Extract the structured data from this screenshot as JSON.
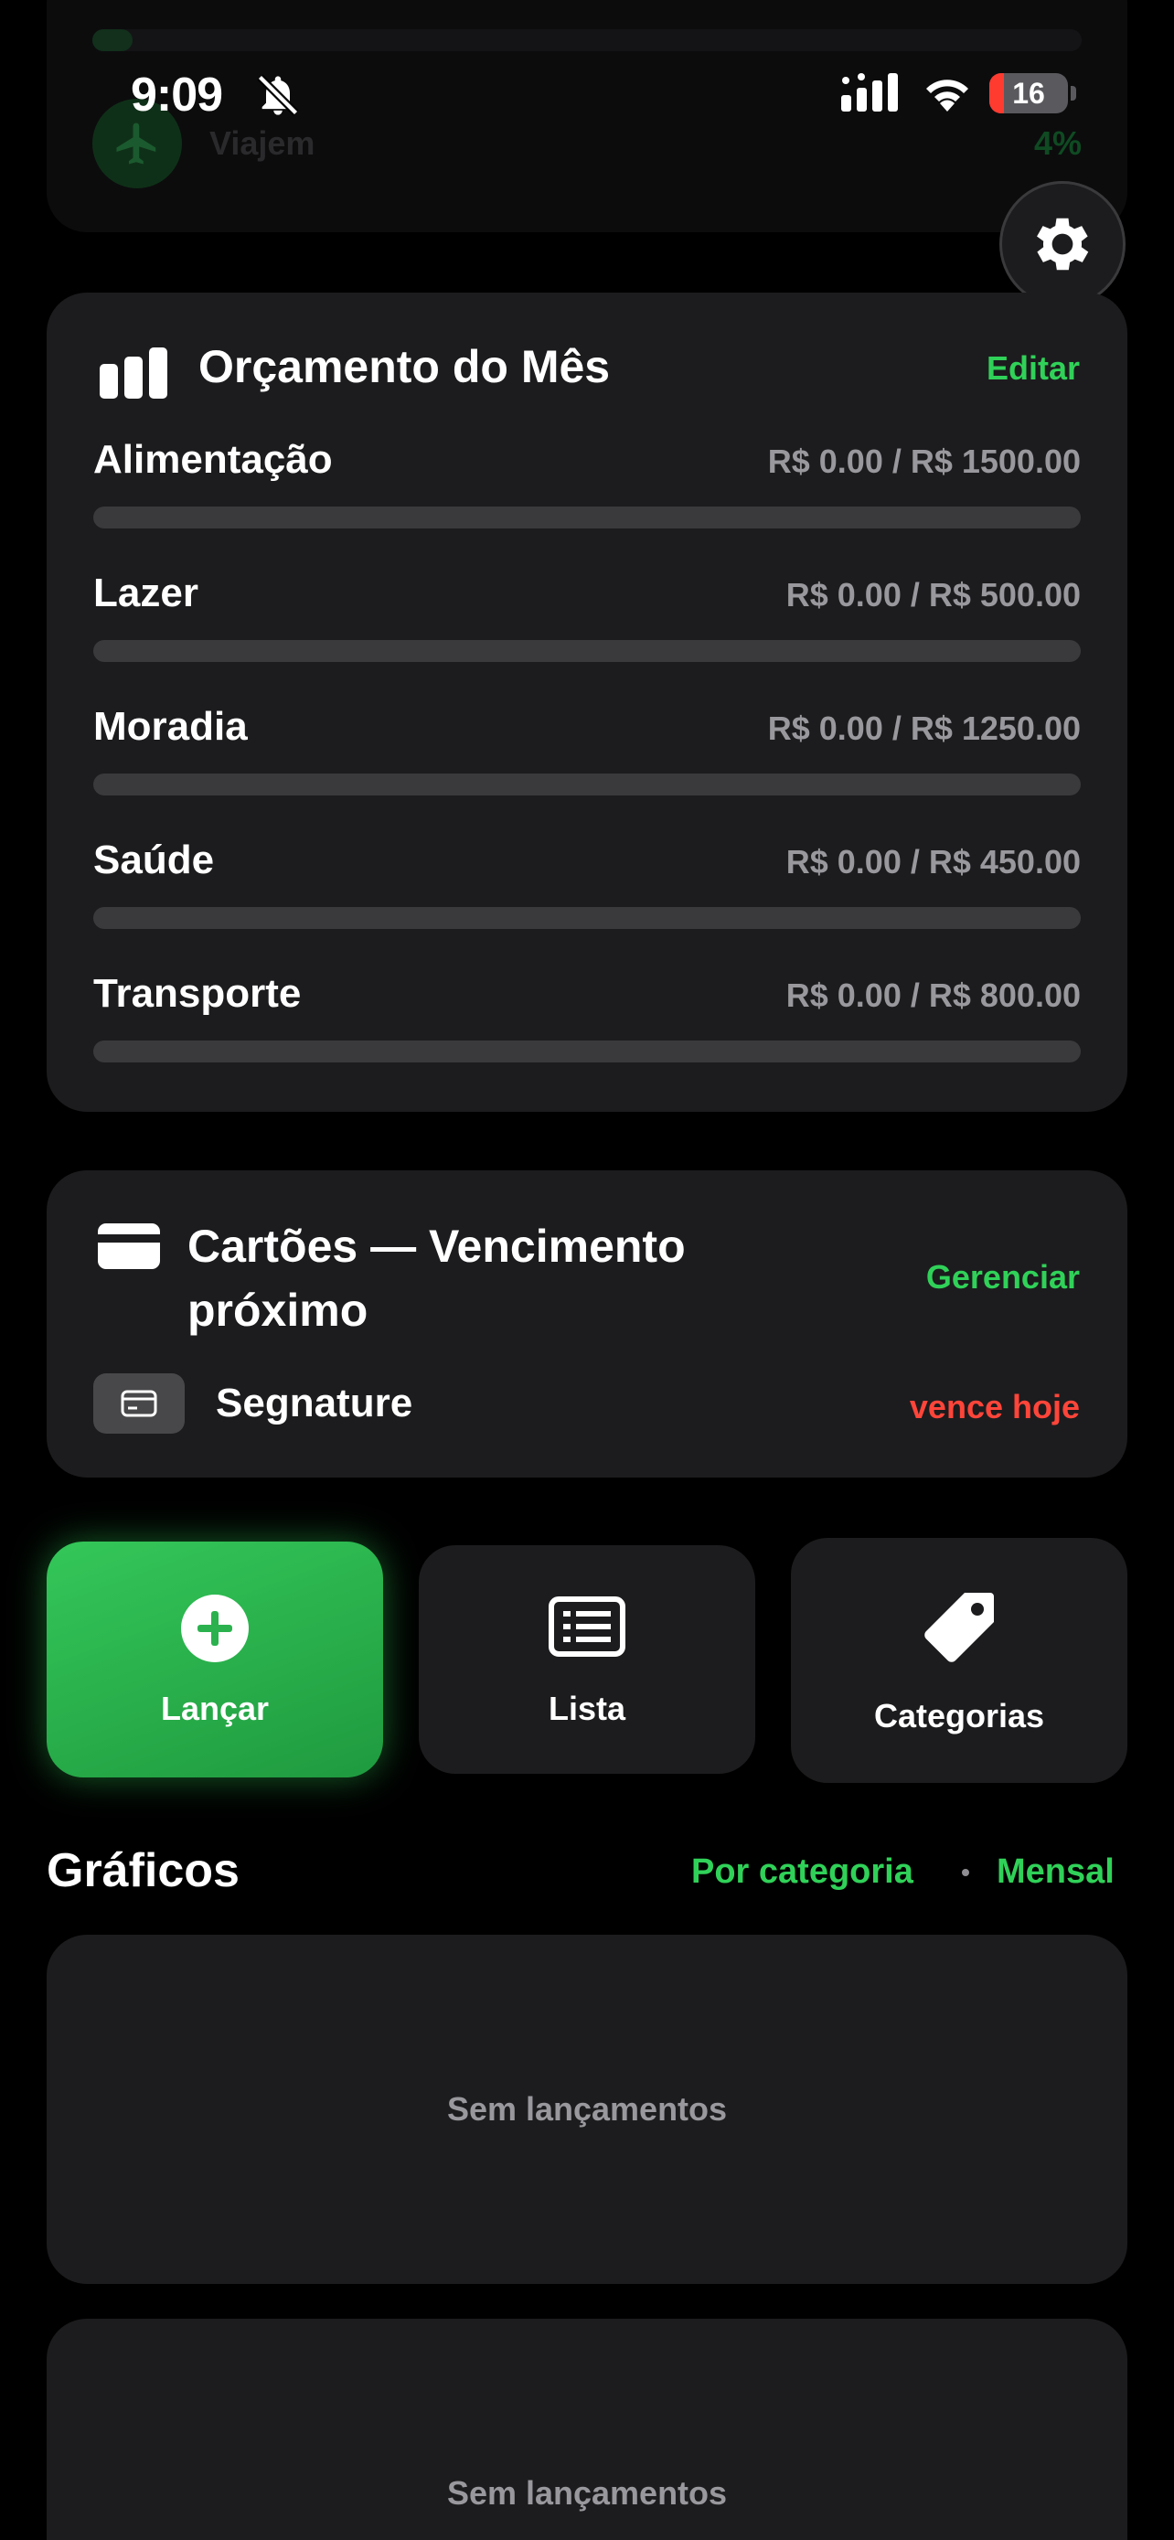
{
  "status_bar": {
    "time": "9:09",
    "battery": "16",
    "icons": [
      "bell-slash-icon",
      "cellular-signal-icon",
      "wifi-icon",
      "battery-icon"
    ]
  },
  "goal": {
    "name": "Viajem",
    "percent": "4%",
    "progress": 0.04,
    "icon": "airplane-icon"
  },
  "settings": {
    "icon": "gear-icon"
  },
  "budget": {
    "title": "Orçamento do Mês",
    "edit_label": "Editar",
    "items": [
      {
        "name": "Alimentação",
        "value": "R$ 0.00 / R$ 1500.00",
        "progress": 0
      },
      {
        "name": "Lazer",
        "value": "R$ 0.00 / R$ 500.00",
        "progress": 0
      },
      {
        "name": "Moradia",
        "value": "R$ 0.00 / R$ 1250.00",
        "progress": 0
      },
      {
        "name": "Saúde",
        "value": "R$ 0.00 / R$ 450.00",
        "progress": 0
      },
      {
        "name": "Transporte",
        "value": "R$ 0.00 / R$ 800.00",
        "progress": 0
      }
    ]
  },
  "cards": {
    "title": "Cartões — Vencimento próximo",
    "manage_label": "Gerenciar",
    "items": [
      {
        "name": "Segnature",
        "due": "vence hoje"
      }
    ]
  },
  "actions": {
    "launch": "Lançar",
    "list": "Lista",
    "categories": "Categorias"
  },
  "charts": {
    "title": "Gráficos",
    "by_category": "Por categoria",
    "monthly": "Mensal",
    "empty_1": "Sem lançamentos",
    "empty_2": "Sem lançamentos"
  },
  "colors": {
    "accent": "#30d158",
    "danger": "#ff453a",
    "card": "#1c1c1e",
    "background": "#000000"
  }
}
